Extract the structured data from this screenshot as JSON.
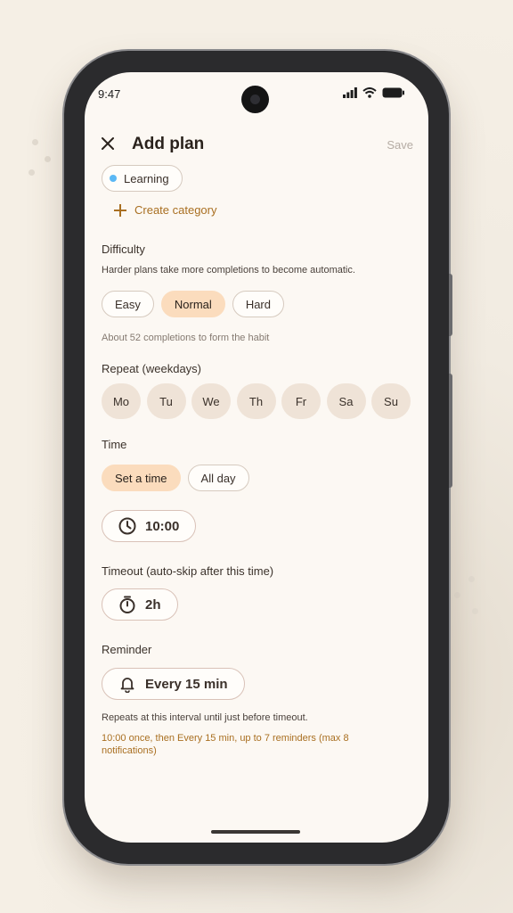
{
  "status": {
    "time": "9:47"
  },
  "header": {
    "title": "Add plan",
    "save_label": "Save"
  },
  "category": {
    "selected_label": "Learning",
    "dot_color": "#5bb8f5",
    "create_label": "Create category"
  },
  "difficulty": {
    "label": "Difficulty",
    "description": "Harder plans take more completions to become automatic.",
    "options": [
      "Easy",
      "Normal",
      "Hard"
    ],
    "selected": "Normal",
    "hint": "About 52 completions to form the habit"
  },
  "repeat": {
    "label": "Repeat (weekdays)",
    "days": [
      "Mo",
      "Tu",
      "We",
      "Th",
      "Fr",
      "Sa",
      "Su"
    ]
  },
  "time": {
    "label": "Time",
    "options": [
      "Set a time",
      "All day"
    ],
    "selected": "Set a time",
    "value": "10:00"
  },
  "timeout": {
    "label": "Timeout (auto-skip after this time)",
    "value": "2h"
  },
  "reminder": {
    "label": "Reminder",
    "value": "Every 15 min",
    "note": "Repeats at this interval until just before timeout.",
    "summary": "10:00 once, then Every 15 min, up to 7 reminders (max 8 notifications)"
  },
  "colors": {
    "accent": "#a96f21",
    "selected_chip": "#fbdcbd",
    "day_bg": "#efe3d7",
    "screen_bg": "#fcf8f3"
  },
  "icons": {
    "close": "close-icon",
    "plus": "plus-icon",
    "clock": "clock-icon",
    "stopwatch": "stopwatch-icon",
    "bell": "bell-icon"
  }
}
